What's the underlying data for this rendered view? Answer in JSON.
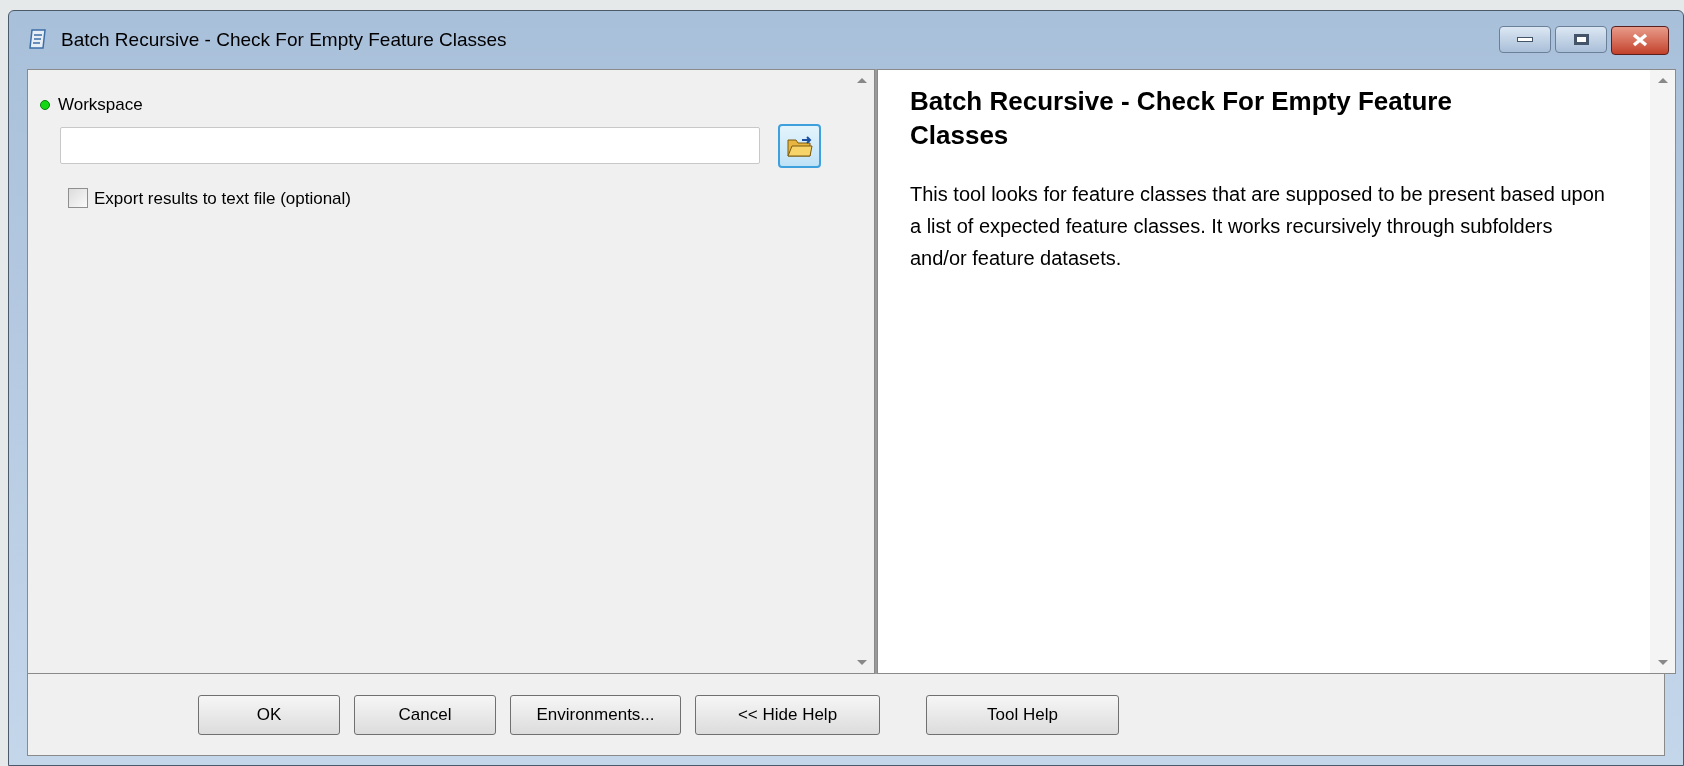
{
  "window": {
    "title": "Batch Recursive - Check For Empty Feature Classes"
  },
  "parameters": [
    {
      "kind": "required-field",
      "label": "Workspace"
    },
    {
      "kind": "checkbox",
      "label": "Export results to text file (optional)",
      "checked": false
    }
  ],
  "help": {
    "title": "Batch Recursive - Check For Empty Feature Classes",
    "body": "This tool looks for feature classes that are supposed to be present based upon a list of expected feature classes. It works recursively through subfolders and/or feature datasets."
  },
  "buttons": [
    {
      "label": "OK"
    },
    {
      "label": "Cancel"
    },
    {
      "label": "Environments..."
    },
    {
      "label": "<< Hide Help"
    },
    {
      "label": "Tool Help"
    }
  ]
}
